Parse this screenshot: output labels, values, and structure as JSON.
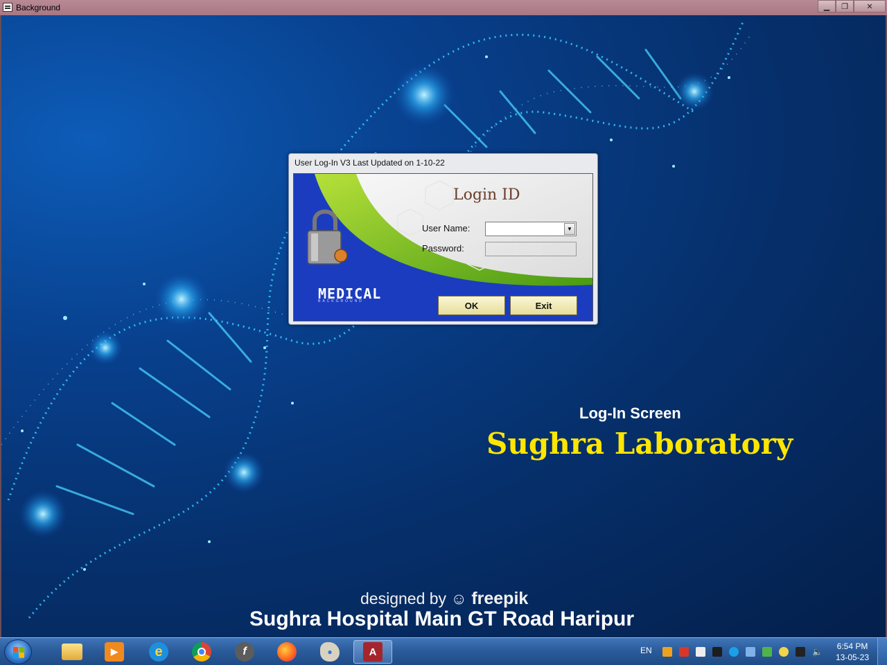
{
  "window": {
    "title": "Background",
    "center_title": "Sughra Laboratory",
    "minimize_icon": "minimize-icon",
    "restore_icon": "restore-icon",
    "close_icon": "close-icon"
  },
  "background": {
    "caption": "Log-In Screen",
    "lab_name": "Sughra Laboratory",
    "designed_by": "designed by",
    "freepik": "freepik",
    "hospital": "Sughra Hospital Main GT Road Haripur",
    "colors": {
      "lab_name": "#ffe600",
      "text": "#ffffff",
      "dna": "#3fd0ff"
    }
  },
  "dialog": {
    "title": "User Log-In V3 Last Updated on 1-10-22",
    "heading": "Login ID",
    "user_label": "User Name:",
    "password_label": "Password:",
    "user_value": "",
    "password_value": "",
    "brand": "MEDICAL",
    "brand_sub": "BACKGROUND",
    "ok_label": "OK",
    "exit_label": "Exit",
    "lock_label": "PRIVATE"
  },
  "taskbar": {
    "apps": [
      {
        "name": "File Explorer",
        "icon": "folder-icon"
      },
      {
        "name": "Media Player",
        "icon": "media-player-icon"
      },
      {
        "name": "Internet Explorer",
        "icon": "internet-explorer-icon"
      },
      {
        "name": "Google Chrome",
        "icon": "chrome-icon"
      },
      {
        "name": "Flash",
        "icon": "flash-icon"
      },
      {
        "name": "Firefox",
        "icon": "firefox-icon"
      },
      {
        "name": "Paint",
        "icon": "paint-icon"
      },
      {
        "name": "Microsoft Access",
        "icon": "access-icon",
        "active": true
      }
    ],
    "language": "EN",
    "time": "6:54 PM",
    "date": "13-05-23"
  }
}
